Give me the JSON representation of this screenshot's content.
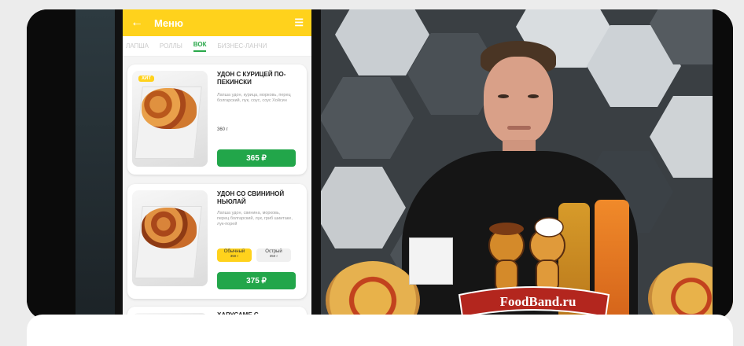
{
  "app": {
    "header_title": "Меню",
    "tabs": [
      "ЛАПША",
      "РОЛЛЫ",
      "ВОК",
      "БИЗНЕС-ЛАНЧИ"
    ],
    "active_tab": "ВОК"
  },
  "menu_items": [
    {
      "badge": "ХИТ",
      "name": "УДОН С КУРИЦЕЙ ПО-ПЕКИНСКИ",
      "description": "Лапша удон, курица, морковь, перец болгарский, лук, соус, соус Хойсин",
      "weight": "360 г",
      "price": "365 ₽"
    },
    {
      "name": "УДОН СО СВИНИНОЙ НЬЮЛАЙ",
      "description": "Лапша удон, свинина, морковь, перец болгарский, лук, гриб шиитаке, лук-порей",
      "option_regular": "Обычный",
      "option_regular_sub": "350 г",
      "option_spicy": "Острый",
      "option_spicy_sub": "350 г",
      "price": "375 ₽"
    },
    {
      "name": "ХАРУСАМЕ С"
    }
  ],
  "logo_text": "FoodBand.ru",
  "colors": {
    "accent_yellow": "#ffd21c",
    "price_green": "#22a64a"
  }
}
